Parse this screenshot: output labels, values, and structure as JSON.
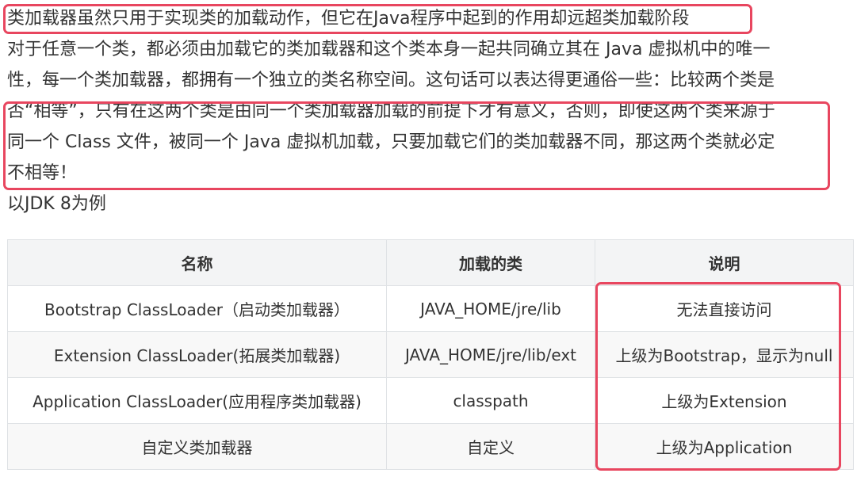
{
  "heading": "类加载器虽然只用于实现类的加载动作，但它在Java程序中起到的作用却远超类加载阶段",
  "paragraph_lines": [
    "对于任意一个类，都必须由加载它的类加载器和这个类本身一起共同确立其在 Java 虚拟机中的唯一",
    "性，每一个类加载器，都拥有一个独立的类名称空间。这句话可以表达得更通俗一些：比较两个类是",
    "否“相等”，只有在这两个类是由同一个类加载器加载的前提下才有意义，否则，即使这两个类来源于",
    "同一个 Class 文件，被同一个 Java 虚拟机加载，只要加载它们的类加载器不同，那这两个类就必定",
    "不相等！"
  ],
  "example_label": "以JDK 8为例",
  "table": {
    "headers": [
      "名称",
      "加载的类",
      "说明"
    ],
    "rows": [
      [
        "Bootstrap ClassLoader（启动类加载器）",
        "JAVA_HOME/jre/lib",
        "无法直接访问"
      ],
      [
        "Extension ClassLoader(拓展类加载器)",
        "JAVA_HOME/jre/lib/ext",
        "上级为Bootstrap，显示为null"
      ],
      [
        "Application ClassLoader(应用程序类加载器)",
        "classpath",
        "上级为Extension"
      ],
      [
        "自定义类加载器",
        "自定义",
        "上级为Application"
      ]
    ]
  },
  "colors": {
    "text": "#333333",
    "highlight_border": "#e8465f",
    "table_border": "#dfe2e5",
    "header_bg": "#f3f4f5",
    "alt_row_bg": "#f8f8f8"
  }
}
